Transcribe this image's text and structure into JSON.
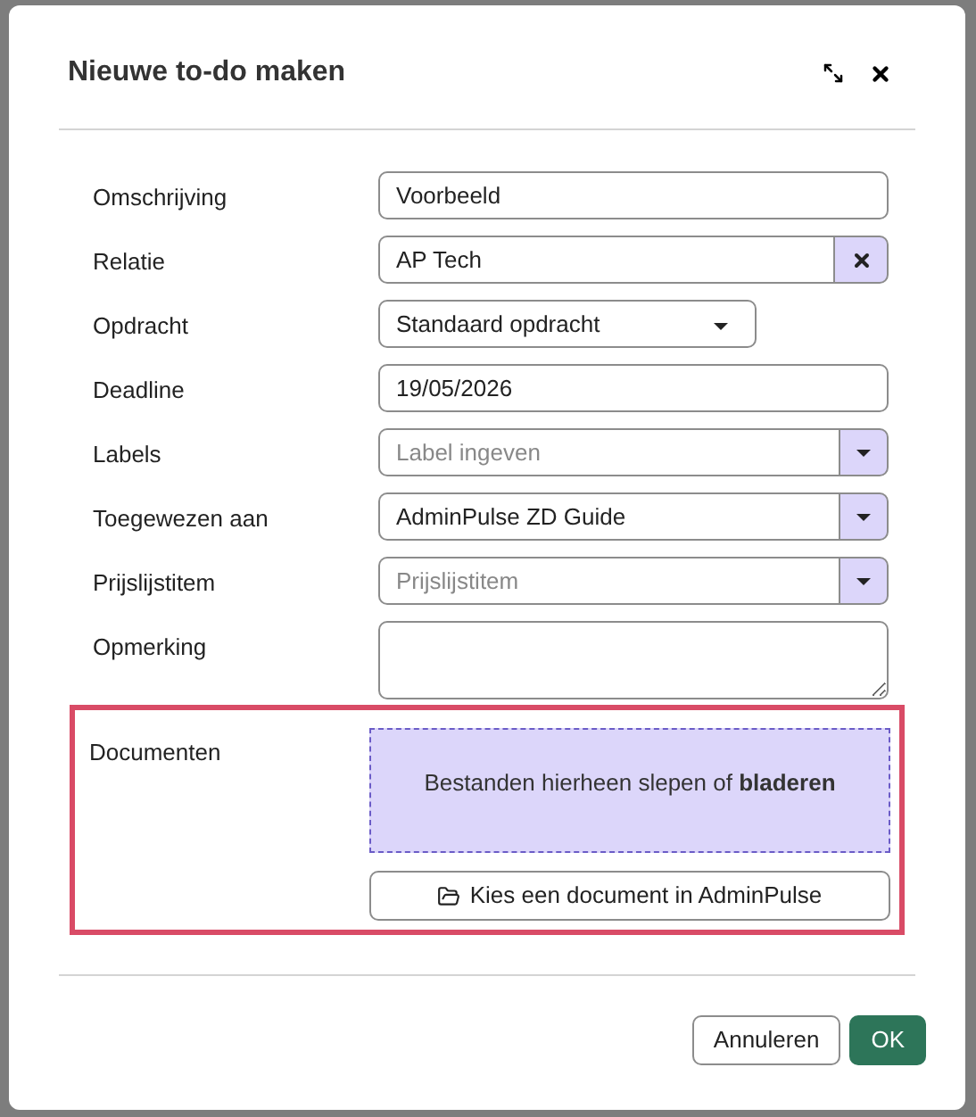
{
  "dialog": {
    "title": "Nieuwe to-do maken"
  },
  "fields": [
    {
      "kind": "text",
      "label": "Omschrijving",
      "value": "Voorbeeld"
    },
    {
      "kind": "clearable",
      "label": "Relatie",
      "value": "AP Tech"
    },
    {
      "kind": "select",
      "label": "Opdracht",
      "value": "Standaard opdracht"
    },
    {
      "kind": "text",
      "label": "Deadline",
      "value": "19/05/2026"
    },
    {
      "kind": "combo",
      "label": "Labels",
      "placeholder": "Label ingeven"
    },
    {
      "kind": "combo",
      "label": "Toegewezen aan",
      "value": "AdminPulse ZD Guide"
    },
    {
      "kind": "combo",
      "label": "Prijslijstitem",
      "placeholder": "Prijslijstitem"
    },
    {
      "kind": "textarea",
      "label": "Opmerking"
    }
  ],
  "documents": {
    "label": "Documenten",
    "highlighted": true,
    "dropzone_text": "Bestanden hierheen slepen of **bladeren**",
    "pick_button": "Kies een document in AdminPulse"
  },
  "buttons": [
    {
      "kind": "secondary",
      "label": "Annuleren"
    },
    {
      "kind": "primary",
      "label": "OK"
    }
  ]
}
